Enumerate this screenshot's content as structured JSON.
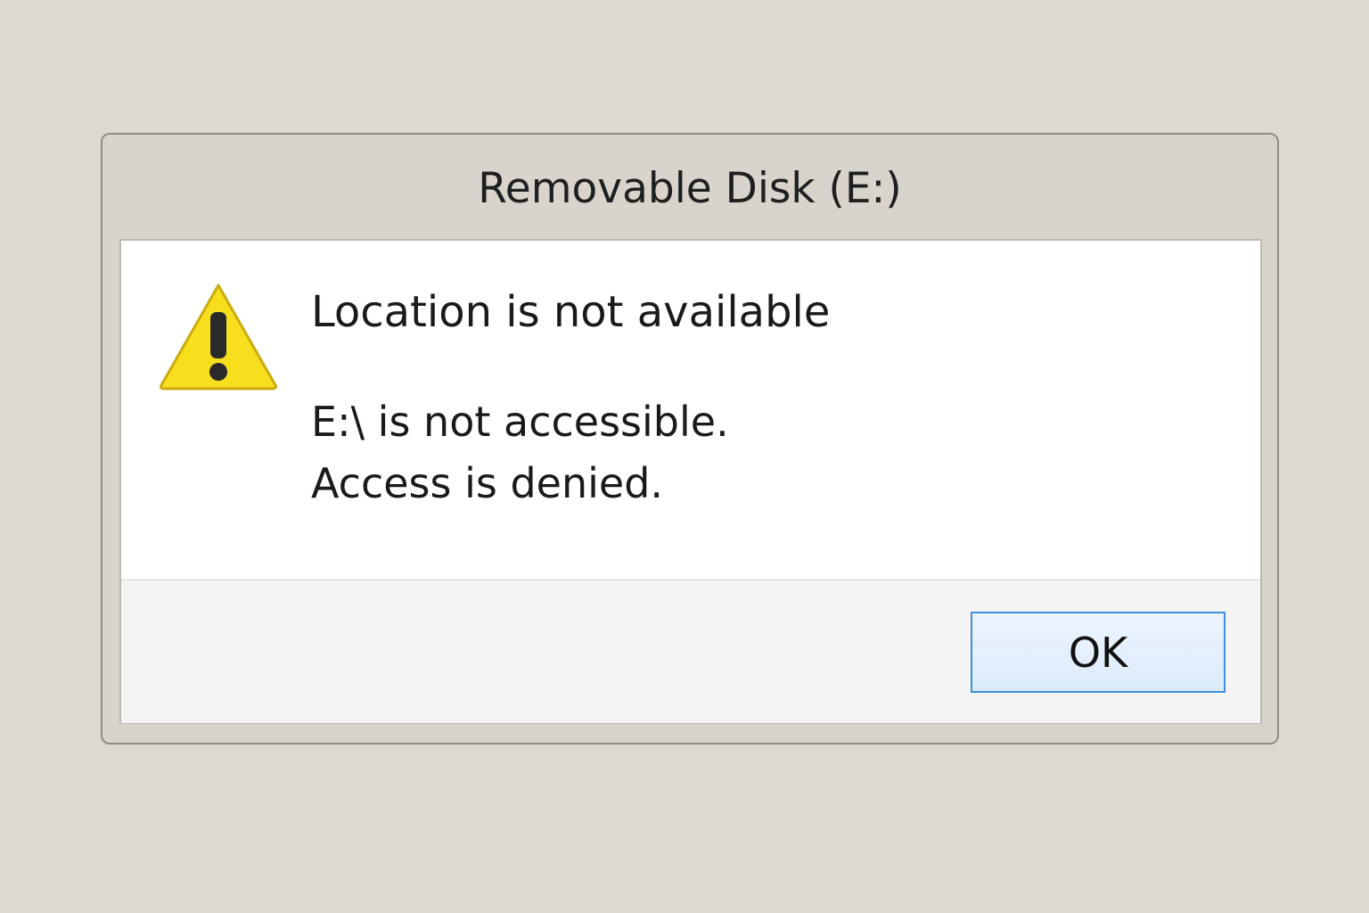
{
  "dialog": {
    "title": "Removable Disk (E:)",
    "icon": "warning-icon",
    "heading": "Location is not available",
    "message_line1": "E:\\ is not accessible.",
    "message_line2": "Access is denied.",
    "ok_label": "OK"
  },
  "colors": {
    "desktop_background": "#ddd9d1",
    "titlebar": "#d8d4cb",
    "warning_yellow": "#f7df1e",
    "button_border": "#3f8edc",
    "button_fill": "#dcebfc"
  }
}
